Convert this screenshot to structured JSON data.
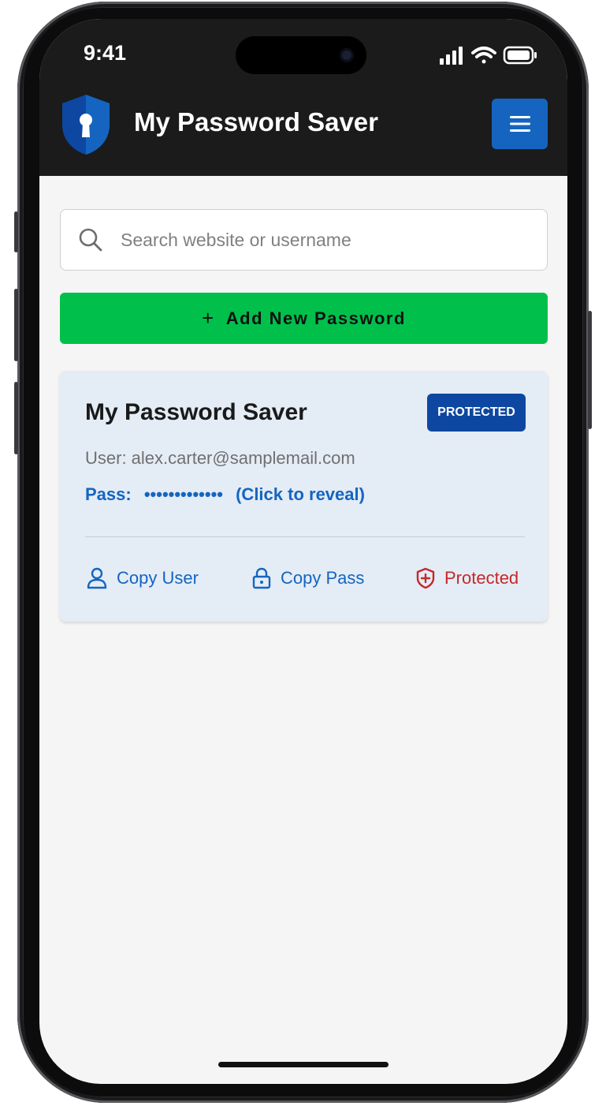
{
  "status_bar": {
    "time": "9:41"
  },
  "app_bar": {
    "title": "My Password Saver",
    "menu_icon": "hamburger-menu-icon",
    "logo_icon": "shield-keyhole-icon"
  },
  "search": {
    "placeholder": "Search website or username",
    "value": ""
  },
  "add_button": {
    "label": "Add New Password",
    "icon": "plus"
  },
  "entries": [
    {
      "title": "My Password Saver",
      "badge": "PROTECTED",
      "user_line": "User: alex.carter@samplemail.com",
      "pass_label": "Pass:",
      "pass_mask": "•••••••••••••",
      "reveal_text": "(Click to reveal)",
      "actions": {
        "copy_user": "Copy User",
        "copy_pass": "Copy Pass",
        "protected": "Protected"
      }
    }
  ],
  "colors": {
    "app_bar": "#1b1b1b",
    "accent_blue": "#1565c0",
    "badge_blue": "#0d47a1",
    "add_green": "#00c04b",
    "card_bg": "#e4ecf6",
    "protected_red": "#c62828"
  }
}
